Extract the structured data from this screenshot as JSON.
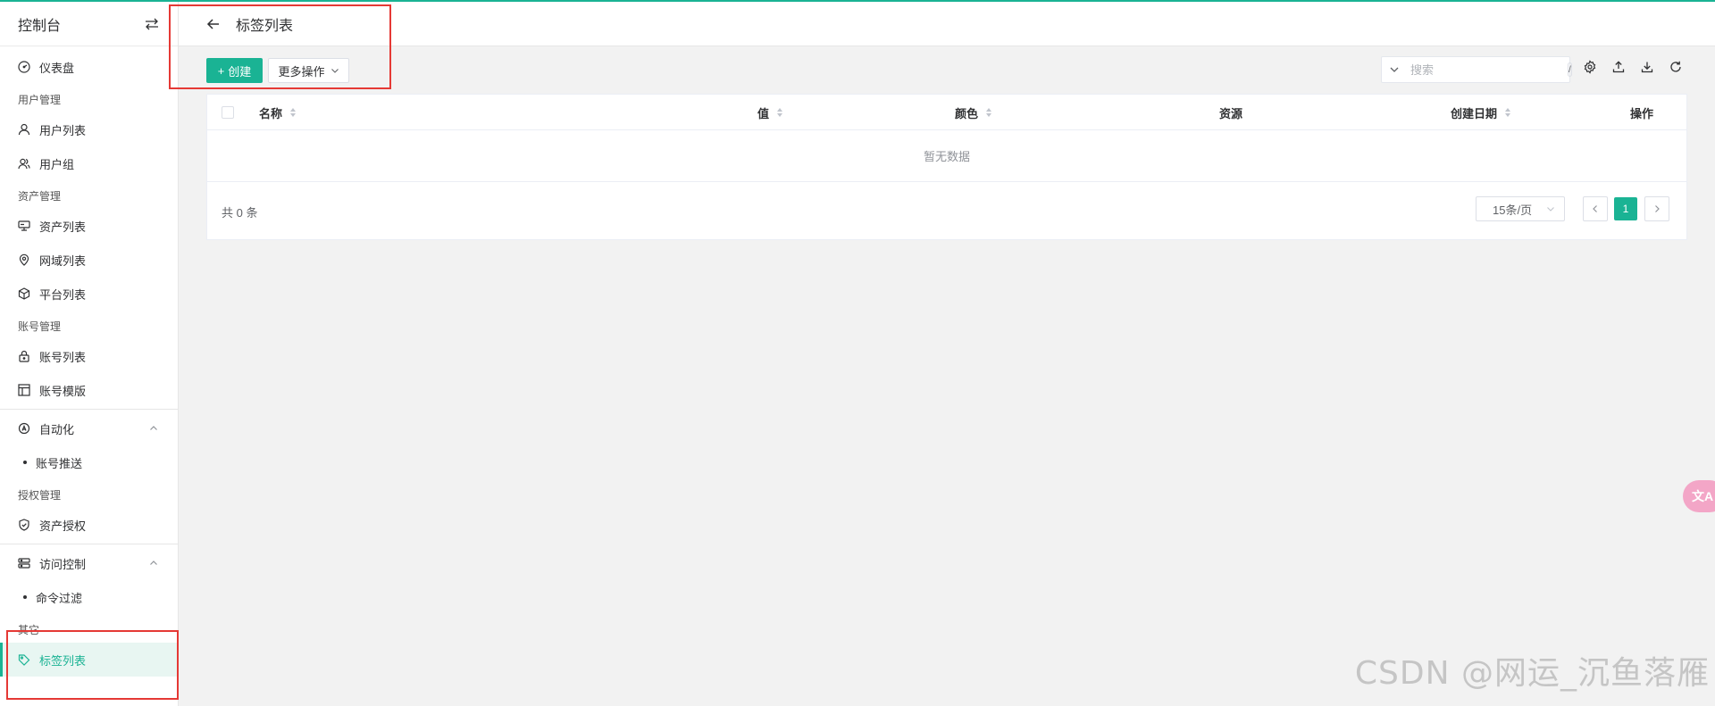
{
  "sidebar": {
    "title": "控制台",
    "items": [
      {
        "label": "仪表盘"
      },
      {
        "group": "用户管理"
      },
      {
        "label": "用户列表"
      },
      {
        "label": "用户组"
      },
      {
        "group": "资产管理"
      },
      {
        "label": "资产列表"
      },
      {
        "label": "网域列表"
      },
      {
        "label": "平台列表"
      },
      {
        "group": "账号管理"
      },
      {
        "label": "账号列表"
      },
      {
        "label": "账号模版"
      },
      {
        "label": "自动化"
      },
      {
        "sub": "账号推送"
      },
      {
        "group": "授权管理"
      },
      {
        "label": "资产授权"
      },
      {
        "label": "访问控制"
      },
      {
        "sub": "命令过滤"
      },
      {
        "group": "其它"
      },
      {
        "label": "标签列表"
      }
    ]
  },
  "header": {
    "title": "标签列表"
  },
  "toolbar": {
    "create_label": "创建",
    "more_label": "更多操作",
    "search_placeholder": "搜索",
    "slash_key": "/"
  },
  "table": {
    "columns": [
      "名称",
      "值",
      "颜色",
      "资源",
      "创建日期",
      "操作"
    ],
    "empty_text": "暂无数据",
    "total": "共 0 条",
    "page_size": "15条/页",
    "current_page": "1"
  },
  "watermark": "CSDN @网运_沉鱼落雁",
  "colors": {
    "accent": "#1ab394",
    "highlight": "#e53935"
  }
}
